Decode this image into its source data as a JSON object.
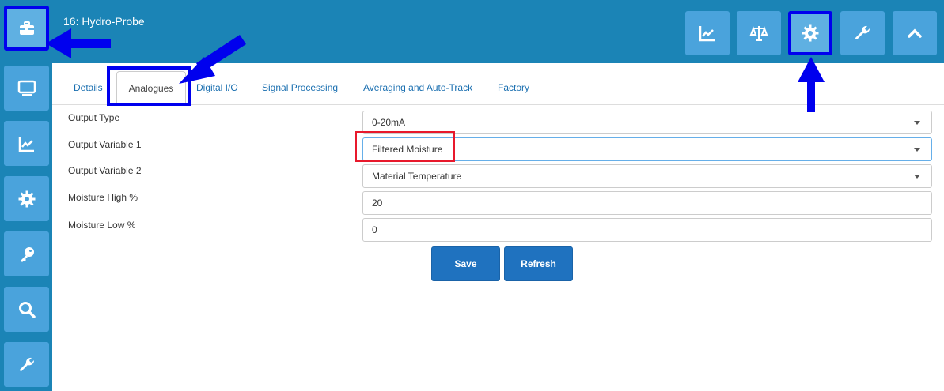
{
  "header": {
    "title": "16: Hydro-Probe"
  },
  "sidebar": {
    "items": [
      {
        "icon": "toolbox-icon",
        "active": true
      },
      {
        "icon": "monitor-icon",
        "active": false
      },
      {
        "icon": "chart-icon",
        "active": false
      },
      {
        "icon": "gear-icon",
        "active": false
      },
      {
        "icon": "key-icon",
        "active": false
      },
      {
        "icon": "search-icon",
        "active": false
      },
      {
        "icon": "wrench-icon",
        "active": false
      }
    ]
  },
  "toolbar": {
    "buttons": [
      {
        "icon": "chart-icon",
        "active": false
      },
      {
        "icon": "balance-scale-icon",
        "active": false
      },
      {
        "icon": "gear-icon",
        "active": true
      },
      {
        "icon": "wrench-icon",
        "active": false
      },
      {
        "icon": "chevron-up-icon",
        "active": false
      }
    ]
  },
  "tabs": [
    {
      "label": "Details"
    },
    {
      "label": "Analogues",
      "active": true
    },
    {
      "label": "Digital I/O"
    },
    {
      "label": "Signal Processing"
    },
    {
      "label": "Averaging and Auto-Track"
    },
    {
      "label": "Factory"
    }
  ],
  "form": {
    "fields": [
      {
        "label": "Output Type",
        "value": "0-20mA",
        "type": "select"
      },
      {
        "label": "Output Variable 1",
        "value": "Filtered Moisture",
        "type": "select"
      },
      {
        "label": "Output Variable 2",
        "value": "Material Temperature",
        "type": "select"
      },
      {
        "label": "Moisture High %",
        "value": "20",
        "type": "input"
      },
      {
        "label": "Moisture Low %",
        "value": "0",
        "type": "input"
      }
    ],
    "save_label": "Save",
    "refresh_label": "Refresh"
  },
  "colors": {
    "brand": "#1b84b6",
    "button": "#4aa3dc",
    "primary": "#1f72bf",
    "annotation": "#0000ee",
    "highlight": "#e8192c"
  }
}
